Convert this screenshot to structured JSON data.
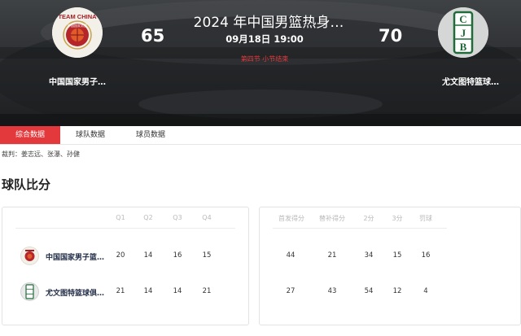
{
  "match": {
    "title": "2024 年中国男篮热身…",
    "time": "09月18日 19:00",
    "status": "第四节 小节结束"
  },
  "home": {
    "name": "中国国家男子…",
    "score": "65",
    "logo_text": "TEAM CHINA",
    "logo_sub": "中国国家男篮"
  },
  "away": {
    "name": "尤文图特篮球…",
    "score": "70",
    "logo_letters": [
      "C",
      "J",
      "B"
    ]
  },
  "tabs": [
    "综合数据",
    "球队数据",
    "球员数据"
  ],
  "referee": "裁判：姜志远、张瀑、孙健",
  "section_title": "球队比分",
  "quarters": {
    "headers": [
      "Q1",
      "Q2",
      "Q3",
      "Q4"
    ],
    "rows": [
      {
        "team": "中国国家男子篮…",
        "values": [
          "20",
          "14",
          "16",
          "15"
        ]
      },
      {
        "team": "尤文图特篮球俱…",
        "values": [
          "21",
          "14",
          "14",
          "21"
        ]
      }
    ]
  },
  "stats": {
    "headers": [
      "首发得分",
      "替补得分",
      "2分",
      "3分",
      "罚球"
    ],
    "rows": [
      {
        "values": [
          "44",
          "21",
          "34",
          "15",
          "16"
        ]
      },
      {
        "values": [
          "27",
          "43",
          "54",
          "12",
          "4"
        ]
      }
    ]
  },
  "colors": {
    "accent": "#e4393c",
    "hero_dark": "#2a2c2f",
    "away_green": "#1f6b3a"
  }
}
